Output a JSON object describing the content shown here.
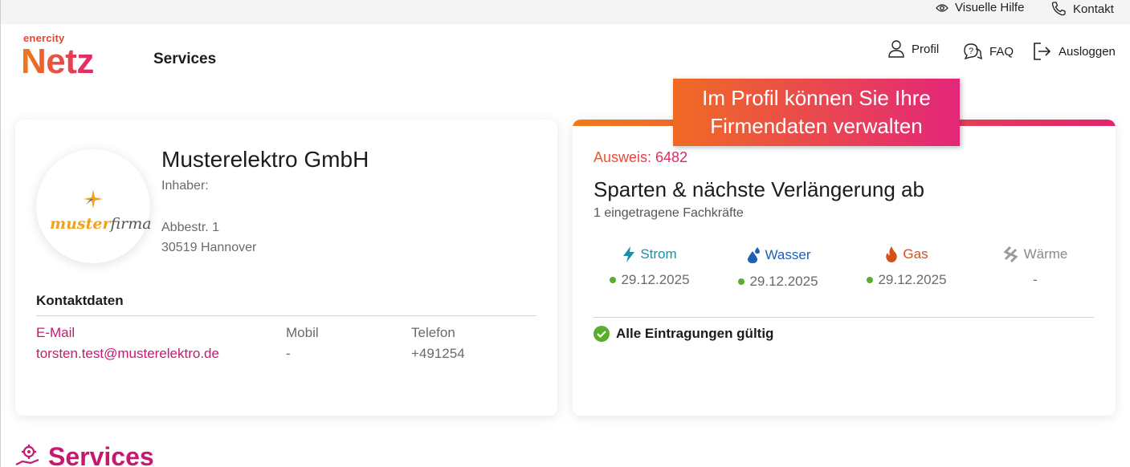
{
  "topbar": {
    "visual_help": "Visuelle Hilfe",
    "contact": "Kontakt"
  },
  "header": {
    "logo_small": "enercity",
    "logo_big": "Netz",
    "nav_services": "Services",
    "profile": "Profil",
    "faq": "FAQ",
    "logout": "Ausloggen"
  },
  "callout": {
    "line1": "Im Profil können Sie Ihre",
    "line2": "Firmendaten verwalten"
  },
  "company_card": {
    "logo_text_a": "muster",
    "logo_text_b": "firma",
    "name": "Musterelektro GmbH",
    "owner_label": "Inhaber:",
    "street": "Abbestr. 1",
    "city": "30519 Hannover",
    "contact_heading": "Kontaktdaten",
    "email_label": "E-Mail",
    "email_value": "torsten.test@musterelektro.de",
    "mobile_label": "Mobil",
    "mobile_value": "-",
    "phone_label": "Telefon",
    "phone_value": "+491254"
  },
  "id_card": {
    "ausweis": "Ausweis: 6482",
    "heading": "Sparten & nächste Verlängerung ab",
    "subheading": "1 eingetragene Fachkräfte",
    "sparten": [
      {
        "name": "Strom",
        "date": "29.12.2025",
        "color": "#1b8fa8",
        "icon": "lightning-icon"
      },
      {
        "name": "Wasser",
        "date": "29.12.2025",
        "color": "#1f5fb8",
        "icon": "water-drop-icon"
      },
      {
        "name": "Gas",
        "date": "29.12.2025",
        "color": "#d4501a",
        "icon": "flame-icon"
      },
      {
        "name": "Wärme",
        "date": "-",
        "color": "#8a8a8a",
        "icon": "heat-icon"
      }
    ],
    "status": "Alle Eintragungen gültig"
  },
  "section": {
    "services_title": "Services"
  },
  "colors": {
    "brand_orange": "#f07a1a",
    "brand_magenta": "#e1256d",
    "valid_green": "#58ad2c"
  }
}
